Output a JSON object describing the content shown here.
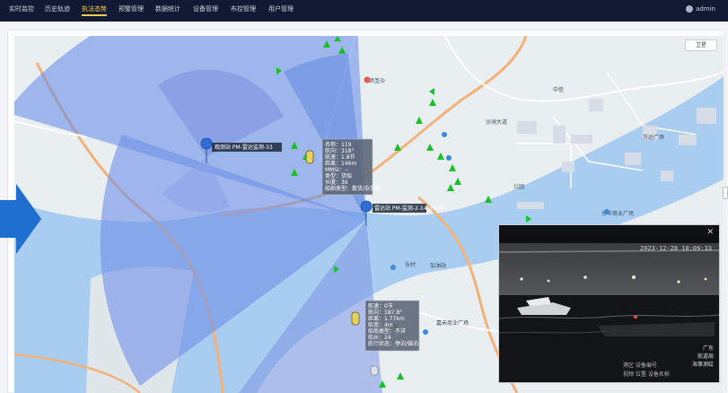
{
  "nav": {
    "items": [
      {
        "label": "实时监控"
      },
      {
        "label": "历史轨迹"
      },
      {
        "label": "执法态势"
      },
      {
        "label": "预警管理"
      },
      {
        "label": "数据统计"
      },
      {
        "label": "设备管理"
      },
      {
        "label": "布控管理"
      },
      {
        "label": "用户管理"
      }
    ],
    "active_index": 2,
    "active_color": "#f2c94c"
  },
  "user": {
    "name": "admin"
  },
  "map": {
    "zoom_label": "卫星",
    "stations": [
      {
        "label": "观测站 PM-雷达监测-33"
      },
      {
        "label": "雷达站 PM-监测-2-14-300M"
      }
    ],
    "popups": [
      {
        "lines": [
          "名称：119",
          "航向：318°",
          "航速：1.8节",
          "距离：146m",
          "MMSI：--",
          "类型：货船",
          "长度：36",
          "船舶类型：散货/杂货船"
        ]
      },
      {
        "lines": [
          "航速：0节",
          "航向：187.8°",
          "距离：1.77km",
          "船宽：4m",
          "船舶类型：不详",
          "船长：24",
          "航行状态：停泊/锚泊"
        ]
      }
    ],
    "places": [
      "洪圣沙",
      "沙洲大道",
      "公园",
      "乐华商业广场",
      "东村",
      "嘉禾商业广场",
      "中信",
      "万达广场",
      "加油站"
    ]
  },
  "video": {
    "timestamp": "2023-12-28 18:09:33",
    "corner_lines": [
      "广东",
      "航道局",
      "海事测绘"
    ],
    "bottom_lines": [
      "港区 设备编号",
      "视频 位置 设备名称"
    ]
  }
}
